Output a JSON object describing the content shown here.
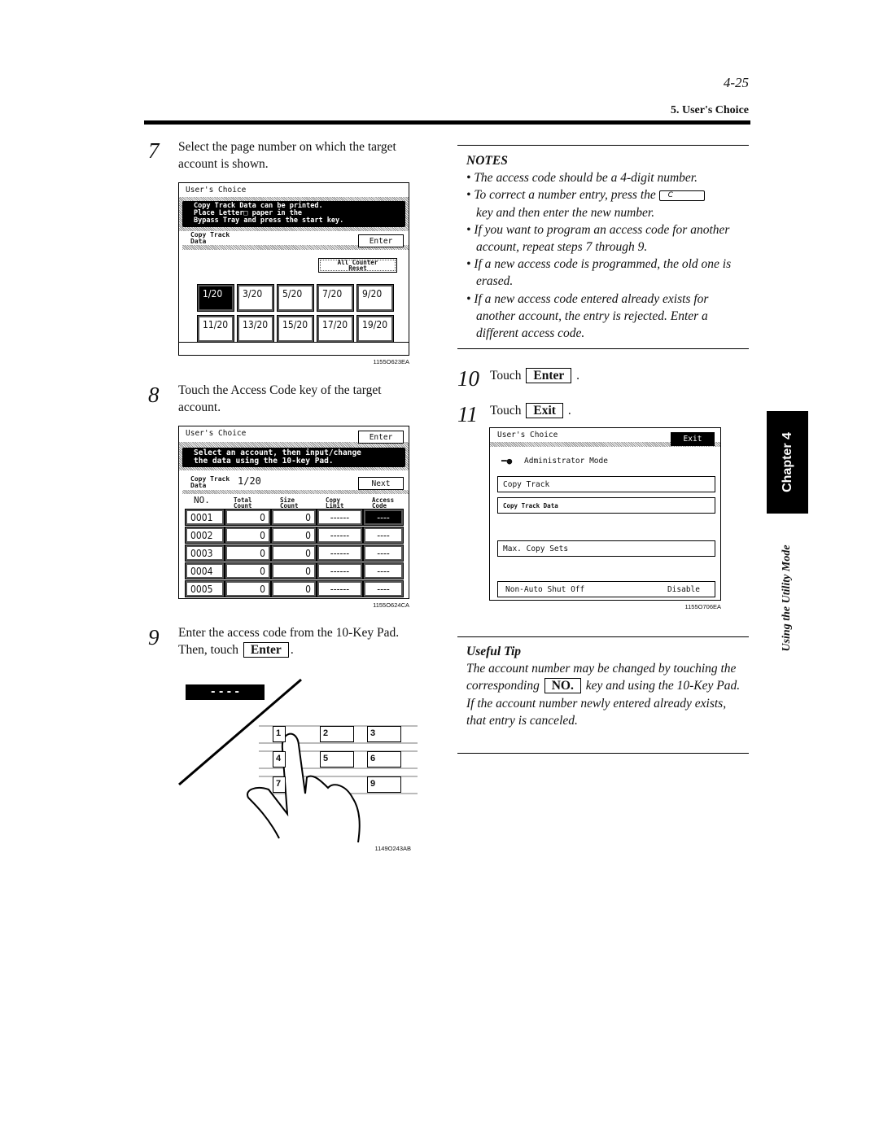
{
  "header": {
    "page_number": "4-25",
    "section": "5. User's Choice"
  },
  "steps": [
    {
      "num": "7",
      "text": "Select the page number on which the target account is shown."
    },
    {
      "num": "8",
      "text": "Touch the Access Code key of the target account."
    },
    {
      "num": "9",
      "text": "Enter the access code from the 10-Key Pad.",
      "text2": "Then, touch",
      "key": "Enter"
    },
    {
      "num": "10",
      "text": "Touch",
      "key": "Enter"
    },
    {
      "num": "11",
      "text": "Touch",
      "key": "Exit"
    }
  ],
  "screen1": {
    "title": "User's Choice",
    "message": [
      "Copy Track Data can be printed.",
      "Place Letter□ paper in the",
      "Bypass Tray and press the start key."
    ],
    "tab": [
      "Copy Track",
      "Data"
    ],
    "enter": "Enter",
    "reset": [
      "All Counter",
      "Reset"
    ],
    "pages": [
      "1/20",
      "3/20",
      "5/20",
      "7/20",
      "9/20",
      "11/20",
      "13/20",
      "15/20",
      "17/20",
      "19/20"
    ],
    "caption": "1155O623EA"
  },
  "screen2": {
    "title": "User's Choice",
    "enter": "Enter",
    "message": [
      "Select an account, then input/change",
      "the data using the 10-key Pad."
    ],
    "tab": [
      "Copy Track",
      "Data"
    ],
    "page": "1/20",
    "next": "Next",
    "columns": [
      "NO.",
      "Total Count",
      "Size Count",
      "Copy Limit",
      "Access Code"
    ],
    "rows": [
      [
        "0001",
        "0",
        "0",
        "------",
        "----"
      ],
      [
        "0002",
        "0",
        "0",
        "------",
        "----"
      ],
      [
        "0003",
        "0",
        "0",
        "------",
        "----"
      ],
      [
        "0004",
        "0",
        "0",
        "------",
        "----"
      ],
      [
        "0005",
        "0",
        "0",
        "------",
        "----"
      ]
    ],
    "caption": "1155O624CA"
  },
  "keypad": {
    "display": "- - - -",
    "keys": [
      "1",
      "2",
      "3",
      "4",
      "5",
      "6",
      "7",
      "9"
    ],
    "caption": "1149O243AB"
  },
  "notes": {
    "title": "NOTES",
    "items": [
      "The access code should be a 4-digit number.",
      "To correct a number entry, press the",
      "key and then enter the new number.",
      "If you want to program an access code for another account, repeat steps 7 through 9.",
      "If a new access code is programmed, the old one is erased.",
      "If a new access code entered already exists for another account, the entry is rejected. Enter a different access code."
    ],
    "clear_key": "C"
  },
  "screen3": {
    "title": "User's Choice",
    "exit": "Exit",
    "mode": "Administrator Mode",
    "items": [
      "Copy Track",
      "Copy Track Data",
      "Max. Copy Sets",
      "Non-Auto Shut Off"
    ],
    "shutoff_value": "Disable",
    "caption": "1155O706EA"
  },
  "tip": {
    "title": "Useful Tip",
    "text1": "The account number may be changed by touching the corresponding",
    "key": "NO.",
    "text2": "key and using the 10-Key Pad. If the account number newly entered already exists, that entry is canceled."
  },
  "sidebar": {
    "chapter": "Chapter 4",
    "section": "Using the Utility Mode"
  }
}
